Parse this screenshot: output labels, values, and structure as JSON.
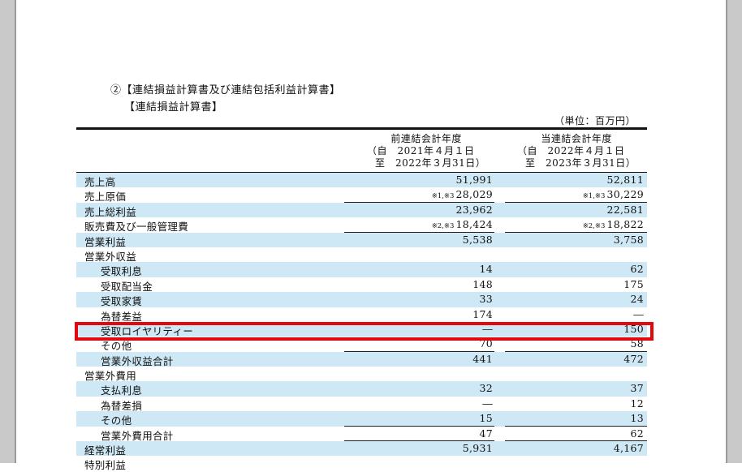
{
  "document": {
    "heading_main": "②【連結損益計算書及び連結包括利益計算書】",
    "heading_sub": "【連結損益計算書】",
    "unit": "（単位：百万円）"
  },
  "columns": [
    {
      "title": "前連結会計年度",
      "from": "（自　2021年４月１日",
      "to": "至　2022年３月31日）"
    },
    {
      "title": "当連結会計年度",
      "from": "（自　2022年４月１日",
      "to": "至　2023年３月31日）"
    }
  ],
  "rows": [
    {
      "label": "売上高",
      "indent": 0,
      "shaded": true,
      "prev": "51,991",
      "curr": "52,811"
    },
    {
      "label": "売上原価",
      "indent": 0,
      "shaded": false,
      "prev_note": "※1,※3",
      "prev": "28,029",
      "curr_note": "※1,※3",
      "curr": "30,229",
      "underline": true
    },
    {
      "label": "売上総利益",
      "indent": 0,
      "shaded": true,
      "prev": "23,962",
      "curr": "22,581"
    },
    {
      "label": "販売費及び一般管理費",
      "indent": 0,
      "shaded": false,
      "prev_note": "※2,※3",
      "prev": "18,424",
      "curr_note": "※2,※3",
      "curr": "18,822",
      "underline": true
    },
    {
      "label": "営業利益",
      "indent": 0,
      "shaded": true,
      "prev": "5,538",
      "curr": "3,758"
    },
    {
      "label": "営業外収益",
      "indent": 0,
      "shaded": false,
      "prev": "",
      "curr": ""
    },
    {
      "label": "受取利息",
      "indent": 1,
      "shaded": true,
      "prev": "14",
      "curr": "62"
    },
    {
      "label": "受取配当金",
      "indent": 1,
      "shaded": false,
      "prev": "148",
      "curr": "175"
    },
    {
      "label": "受取家賃",
      "indent": 1,
      "shaded": true,
      "prev": "33",
      "curr": "24"
    },
    {
      "label": "為替差益",
      "indent": 1,
      "shaded": false,
      "prev": "174",
      "curr": "―"
    },
    {
      "label": "受取ロイヤリティー",
      "indent": 1,
      "shaded": true,
      "prev": "―",
      "curr": "150",
      "highlighted": true
    },
    {
      "label": "その他",
      "indent": 1,
      "shaded": false,
      "prev": "70",
      "curr": "58",
      "underline": true
    },
    {
      "label": "営業外収益合計",
      "indent": 1,
      "shaded": true,
      "prev": "441",
      "curr": "472"
    },
    {
      "label": "営業外費用",
      "indent": 0,
      "shaded": false,
      "prev": "",
      "curr": ""
    },
    {
      "label": "支払利息",
      "indent": 1,
      "shaded": true,
      "prev": "32",
      "curr": "37"
    },
    {
      "label": "為替差損",
      "indent": 1,
      "shaded": false,
      "prev": "―",
      "curr": "12"
    },
    {
      "label": "その他",
      "indent": 1,
      "shaded": true,
      "prev": "15",
      "curr": "13",
      "underline": true
    },
    {
      "label": "営業外費用合計",
      "indent": 1,
      "shaded": false,
      "prev": "47",
      "curr": "62",
      "underline": true
    },
    {
      "label": "経常利益",
      "indent": 0,
      "shaded": true,
      "prev": "5,931",
      "curr": "4,167"
    },
    {
      "label": "特別利益",
      "indent": 0,
      "shaded": false,
      "prev": "",
      "curr": ""
    }
  ],
  "colors": {
    "shade": "#cfe8f5",
    "highlight": "#e3080f"
  }
}
